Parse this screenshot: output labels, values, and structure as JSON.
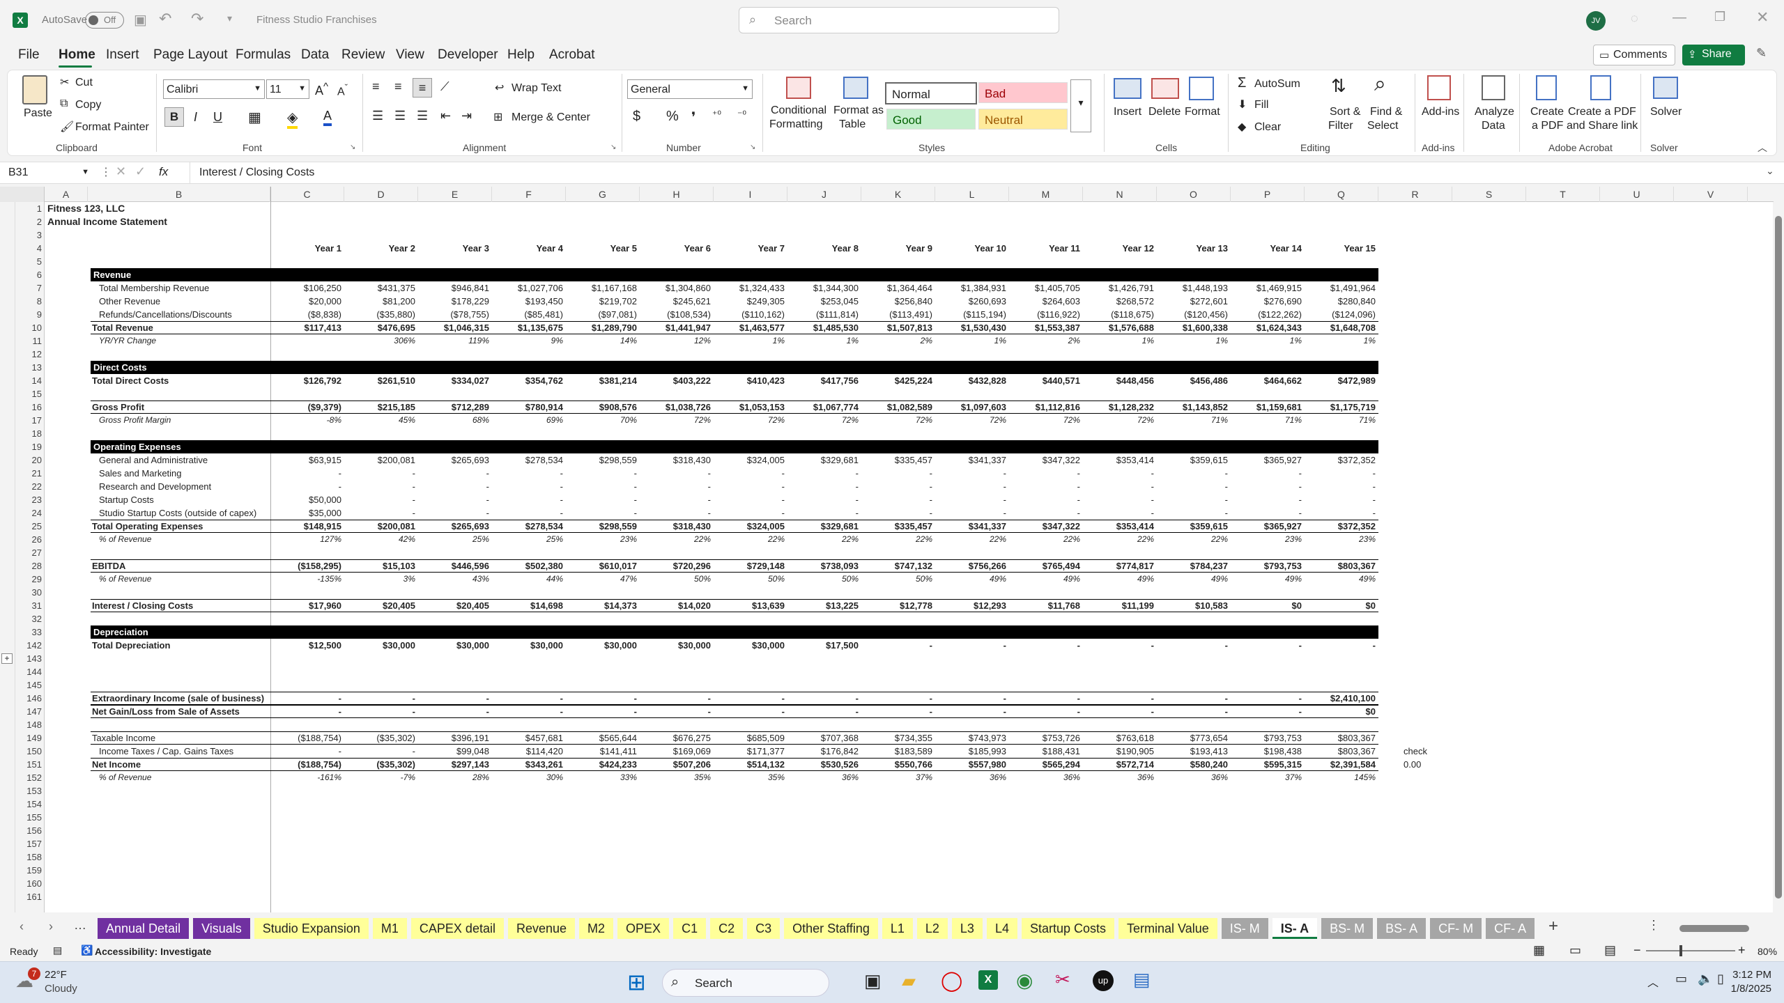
{
  "title": {
    "autosave": "AutoSave",
    "toggle": "Off",
    "filename": "Fitness Studio Franchises",
    "search": "Search",
    "avatar": "JV"
  },
  "menu": [
    "File",
    "Home",
    "Insert",
    "Page Layout",
    "Formulas",
    "Data",
    "Review",
    "View",
    "Developer",
    "Help",
    "Acrobat"
  ],
  "menu_right": {
    "comments": "Comments",
    "share": "Share"
  },
  "ribbon": {
    "paste": "Paste",
    "cut": "Cut",
    "copy": "Copy",
    "format_painter": "Format Painter",
    "clipboard": "Clipboard",
    "font_name": "Calibri",
    "font_size": "11",
    "font": "Font",
    "wrap_text": "Wrap Text",
    "merge_center": "Merge & Center",
    "alignment": "Alignment",
    "number_format": "General",
    "number": "Number",
    "cond_format": "Conditional",
    "cond_format2": "Formatting",
    "format_table": "Format as",
    "format_table2": "Table",
    "style_normal": "Normal",
    "style_bad": "Bad",
    "style_good": "Good",
    "style_neutral": "Neutral",
    "styles": "Styles",
    "insert": "Insert",
    "delete": "Delete",
    "format": "Format",
    "cells": "Cells",
    "autosum": "AutoSum",
    "fill": "Fill",
    "clear": "Clear",
    "sort": "Sort &",
    "sort2": "Filter",
    "find": "Find &",
    "find2": "Select",
    "editing": "Editing",
    "addins": "Add-ins",
    "addins_grp": "Add-ins",
    "analyze": "Analyze",
    "analyze2": "Data",
    "create_pdf": "Create",
    "create_pdf2": "a PDF",
    "create_share": "Create a PDF",
    "create_share2": "and Share link",
    "acrobat": "Adobe Acrobat",
    "solver": "Solver",
    "solver_grp": "Solver"
  },
  "formula_bar": {
    "cell_ref": "B31",
    "fx": "fx",
    "content": "Interest / Closing Costs"
  },
  "columns": [
    "A",
    "B",
    "C",
    "D",
    "E",
    "F",
    "G",
    "H",
    "I",
    "J",
    "K",
    "L",
    "M",
    "N",
    "O",
    "P",
    "Q",
    "R",
    "S",
    "T",
    "U",
    "V"
  ],
  "sheet": {
    "company": "Fitness 123, LLC",
    "statement": "Annual Income Statement",
    "years": [
      "Year 1",
      "Year 2",
      "Year 3",
      "Year 4",
      "Year 5",
      "Year 6",
      "Year 7",
      "Year 8",
      "Year 9",
      "Year 10",
      "Year 11",
      "Year 12",
      "Year 13",
      "Year 14",
      "Year 15"
    ],
    "rows": [
      {
        "n": "1"
      },
      {
        "n": "2"
      },
      {
        "n": "3"
      },
      {
        "n": "4",
        "years": true
      },
      {
        "n": "5"
      },
      {
        "n": "6",
        "band": "Revenue"
      },
      {
        "n": "7",
        "label": "Total Membership Revenue",
        "indent": true,
        "v": [
          "$106,250",
          "$431,375",
          "$946,841",
          "$1,027,706",
          "$1,167,168",
          "$1,304,860",
          "$1,324,433",
          "$1,344,300",
          "$1,364,464",
          "$1,384,931",
          "$1,405,705",
          "$1,426,791",
          "$1,448,193",
          "$1,469,915",
          "$1,491,964"
        ]
      },
      {
        "n": "8",
        "label": "Other Revenue",
        "indent": true,
        "v": [
          "$20,000",
          "$81,200",
          "$178,229",
          "$193,450",
          "$219,702",
          "$245,621",
          "$249,305",
          "$253,045",
          "$256,840",
          "$260,693",
          "$264,603",
          "$268,572",
          "$272,601",
          "$276,690",
          "$280,840"
        ]
      },
      {
        "n": "9",
        "label": "Refunds/Cancellations/Discounts",
        "indent": true,
        "v": [
          "($8,838)",
          "($35,880)",
          "($78,755)",
          "($85,481)",
          "($97,081)",
          "($108,534)",
          "($110,162)",
          "($111,814)",
          "($113,491)",
          "($115,194)",
          "($116,922)",
          "($118,675)",
          "($120,456)",
          "($122,262)",
          "($124,096)"
        ]
      },
      {
        "n": "10",
        "label": "Total Revenue",
        "bold": true,
        "top": true,
        "v": [
          "$117,413",
          "$476,695",
          "$1,046,315",
          "$1,135,675",
          "$1,289,790",
          "$1,441,947",
          "$1,463,577",
          "$1,485,530",
          "$1,507,813",
          "$1,530,430",
          "$1,553,387",
          "$1,576,688",
          "$1,600,338",
          "$1,624,343",
          "$1,648,708"
        ]
      },
      {
        "n": "11",
        "label": "YR/YR Change",
        "ital": true,
        "v": [
          "",
          "306%",
          "119%",
          "9%",
          "14%",
          "12%",
          "1%",
          "1%",
          "2%",
          "1%",
          "2%",
          "1%",
          "1%",
          "1%",
          "1%"
        ]
      },
      {
        "n": "12"
      },
      {
        "n": "13",
        "band": "Direct Costs"
      },
      {
        "n": "14",
        "label": "Total Direct Costs",
        "bold": true,
        "v": [
          "$126,792",
          "$261,510",
          "$334,027",
          "$354,762",
          "$381,214",
          "$403,222",
          "$410,423",
          "$417,756",
          "$425,224",
          "$432,828",
          "$440,571",
          "$448,456",
          "$456,486",
          "$464,662",
          "$472,989"
        ]
      },
      {
        "n": "15"
      },
      {
        "n": "16",
        "label": "Gross Profit",
        "bold": true,
        "top": true,
        "v": [
          "($9,379)",
          "$215,185",
          "$712,289",
          "$780,914",
          "$908,576",
          "$1,038,726",
          "$1,053,153",
          "$1,067,774",
          "$1,082,589",
          "$1,097,603",
          "$1,112,816",
          "$1,128,232",
          "$1,143,852",
          "$1,159,681",
          "$1,175,719"
        ]
      },
      {
        "n": "17",
        "label": "Gross Profit Margin",
        "ital": true,
        "v": [
          "-8%",
          "45%",
          "68%",
          "69%",
          "70%",
          "72%",
          "72%",
          "72%",
          "72%",
          "72%",
          "72%",
          "72%",
          "71%",
          "71%",
          "71%"
        ]
      },
      {
        "n": "18"
      },
      {
        "n": "19",
        "band": "Operating Expenses"
      },
      {
        "n": "20",
        "label": "General and Administrative",
        "indent": true,
        "v": [
          "$63,915",
          "$200,081",
          "$265,693",
          "$278,534",
          "$298,559",
          "$318,430",
          "$324,005",
          "$329,681",
          "$335,457",
          "$341,337",
          "$347,322",
          "$353,414",
          "$359,615",
          "$365,927",
          "$372,352"
        ]
      },
      {
        "n": "21",
        "label": "Sales and Marketing",
        "indent": true,
        "v": [
          "-",
          "-",
          "-",
          "-",
          "-",
          "-",
          "-",
          "-",
          "-",
          "-",
          "-",
          "-",
          "-",
          "-",
          "-"
        ]
      },
      {
        "n": "22",
        "label": "Research and Development",
        "indent": true,
        "v": [
          "-",
          "-",
          "-",
          "-",
          "-",
          "-",
          "-",
          "-",
          "-",
          "-",
          "-",
          "-",
          "-",
          "-",
          "-"
        ]
      },
      {
        "n": "23",
        "label": "Startup Costs",
        "indent": true,
        "v": [
          "$50,000",
          "-",
          "-",
          "-",
          "-",
          "-",
          "-",
          "-",
          "-",
          "-",
          "-",
          "-",
          "-",
          "-",
          "-"
        ]
      },
      {
        "n": "24",
        "label": "Studio Startup Costs (outside of capex)",
        "indent": true,
        "v": [
          "$35,000",
          "-",
          "-",
          "-",
          "-",
          "-",
          "-",
          "-",
          "-",
          "-",
          "-",
          "-",
          "-",
          "-",
          "-"
        ]
      },
      {
        "n": "25",
        "label": "Total Operating Expenses",
        "bold": true,
        "top": true,
        "v": [
          "$148,915",
          "$200,081",
          "$265,693",
          "$278,534",
          "$298,559",
          "$318,430",
          "$324,005",
          "$329,681",
          "$335,457",
          "$341,337",
          "$347,322",
          "$353,414",
          "$359,615",
          "$365,927",
          "$372,352"
        ]
      },
      {
        "n": "26",
        "label": "% of Revenue",
        "ital": true,
        "v": [
          "127%",
          "42%",
          "25%",
          "25%",
          "23%",
          "22%",
          "22%",
          "22%",
          "22%",
          "22%",
          "22%",
          "22%",
          "22%",
          "23%",
          "23%"
        ]
      },
      {
        "n": "27"
      },
      {
        "n": "28",
        "label": "EBITDA",
        "bold": true,
        "top": true,
        "v": [
          "($158,295)",
          "$15,103",
          "$446,596",
          "$502,380",
          "$610,017",
          "$720,296",
          "$729,148",
          "$738,093",
          "$747,132",
          "$756,266",
          "$765,494",
          "$774,817",
          "$784,237",
          "$793,753",
          "$803,367"
        ]
      },
      {
        "n": "29",
        "label": "% of Revenue",
        "ital": true,
        "v": [
          "-135%",
          "3%",
          "43%",
          "44%",
          "47%",
          "50%",
          "50%",
          "50%",
          "50%",
          "49%",
          "49%",
          "49%",
          "49%",
          "49%",
          "49%"
        ]
      },
      {
        "n": "30"
      },
      {
        "n": "31",
        "label": "Interest / Closing Costs",
        "bold": true,
        "top": true,
        "v": [
          "$17,960",
          "$20,405",
          "$20,405",
          "$14,698",
          "$14,373",
          "$14,020",
          "$13,639",
          "$13,225",
          "$12,778",
          "$12,293",
          "$11,768",
          "$11,199",
          "$10,583",
          "$0",
          "$0"
        ]
      },
      {
        "n": "32"
      },
      {
        "n": "33",
        "band": "Depreciation"
      },
      {
        "n": "142",
        "label": "Total Depreciation",
        "bold": true,
        "v": [
          "$12,500",
          "$30,000",
          "$30,000",
          "$30,000",
          "$30,000",
          "$30,000",
          "$30,000",
          "$17,500",
          "-",
          "-",
          "-",
          "-",
          "-",
          "-",
          "-"
        ]
      },
      {
        "n": "143"
      },
      {
        "n": "144"
      },
      {
        "n": "145"
      },
      {
        "n": "146",
        "label": "Extraordinary Income (sale of business)",
        "bold": true,
        "top": true,
        "v": [
          "-",
          "-",
          "-",
          "-",
          "-",
          "-",
          "-",
          "-",
          "-",
          "-",
          "-",
          "-",
          "-",
          "-",
          "$2,410,100"
        ]
      },
      {
        "n": "147",
        "label": "Net Gain/Loss from Sale of Assets",
        "bold": true,
        "top": true,
        "v": [
          "-",
          "-",
          "-",
          "-",
          "-",
          "-",
          "-",
          "-",
          "-",
          "-",
          "-",
          "-",
          "-",
          "-",
          "$0"
        ]
      },
      {
        "n": "148"
      },
      {
        "n": "149",
        "label": "Taxable Income",
        "top": true,
        "v": [
          "($188,754)",
          "($35,302)",
          "$396,191",
          "$457,681",
          "$565,644",
          "$676,275",
          "$685,509",
          "$707,368",
          "$734,355",
          "$743,973",
          "$753,726",
          "$763,618",
          "$773,654",
          "$793,753",
          "$803,367"
        ]
      },
      {
        "n": "150",
        "label": "Income Taxes / Cap. Gains Taxes",
        "indent": true,
        "v": [
          "-",
          "-",
          "$99,048",
          "$114,420",
          "$141,411",
          "$169,069",
          "$171,377",
          "$176,842",
          "$183,589",
          "$185,993",
          "$188,431",
          "$190,905",
          "$193,413",
          "$198,438",
          "$803,367"
        ],
        "extra": "check"
      },
      {
        "n": "151",
        "label": "Net Income",
        "bold": true,
        "top": true,
        "v": [
          "($188,754)",
          "($35,302)",
          "$297,143",
          "$343,261",
          "$424,233",
          "$507,206",
          "$514,132",
          "$530,526",
          "$550,766",
          "$557,980",
          "$565,294",
          "$572,714",
          "$580,240",
          "$595,315",
          "$2,391,584"
        ],
        "extra": "0.00"
      },
      {
        "n": "152",
        "label": "% of Revenue",
        "ital": true,
        "v": [
          "-161%",
          "-7%",
          "28%",
          "30%",
          "33%",
          "35%",
          "35%",
          "36%",
          "37%",
          "36%",
          "36%",
          "36%",
          "36%",
          "37%",
          "145%"
        ]
      },
      {
        "n": "153"
      },
      {
        "n": "154"
      },
      {
        "n": "155"
      },
      {
        "n": "156"
      },
      {
        "n": "157"
      },
      {
        "n": "158"
      },
      {
        "n": "159"
      },
      {
        "n": "160"
      },
      {
        "n": "161"
      }
    ]
  },
  "tabs": [
    {
      "name": "Annual Detail",
      "bg": "#7030a0",
      "fg": "#ffffff"
    },
    {
      "name": "Visuals",
      "bg": "#7030a0",
      "fg": "#ffffff"
    },
    {
      "name": "Studio Expansion",
      "bg": "#ffff99",
      "fg": "#242424"
    },
    {
      "name": "M1",
      "bg": "#ffff99",
      "fg": "#242424"
    },
    {
      "name": "CAPEX detail",
      "bg": "#ffff99",
      "fg": "#242424"
    },
    {
      "name": "Revenue",
      "bg": "#ffff99",
      "fg": "#242424"
    },
    {
      "name": "M2",
      "bg": "#ffff99",
      "fg": "#242424"
    },
    {
      "name": "OPEX",
      "bg": "#ffff99",
      "fg": "#242424"
    },
    {
      "name": "C1",
      "bg": "#ffff99",
      "fg": "#242424"
    },
    {
      "name": "C2",
      "bg": "#ffff99",
      "fg": "#242424"
    },
    {
      "name": "C3",
      "bg": "#ffff99",
      "fg": "#242424"
    },
    {
      "name": "Other Staffing",
      "bg": "#ffff99",
      "fg": "#242424"
    },
    {
      "name": "L1",
      "bg": "#ffff99",
      "fg": "#242424"
    },
    {
      "name": "L2",
      "bg": "#ffff99",
      "fg": "#242424"
    },
    {
      "name": "L3",
      "bg": "#ffff99",
      "fg": "#242424"
    },
    {
      "name": "L4",
      "bg": "#ffff99",
      "fg": "#242424"
    },
    {
      "name": "Startup Costs",
      "bg": "#ffff99",
      "fg": "#242424"
    },
    {
      "name": "Terminal Value",
      "bg": "#ffff99",
      "fg": "#242424"
    },
    {
      "name": "IS- M",
      "bg": "#a6a6a6",
      "fg": "#ffffff"
    },
    {
      "name": "IS- A",
      "bg": "#ffffff",
      "fg": "#242424",
      "active": true
    },
    {
      "name": "BS- M",
      "bg": "#a6a6a6",
      "fg": "#ffffff"
    },
    {
      "name": "BS- A",
      "bg": "#a6a6a6",
      "fg": "#ffffff"
    },
    {
      "name": "CF- M",
      "bg": "#a6a6a6",
      "fg": "#ffffff"
    },
    {
      "name": "CF- A",
      "bg": "#a6a6a6",
      "fg": "#ffffff"
    }
  ],
  "status": {
    "ready": "Ready",
    "accessibility": "Accessibility: Investigate",
    "zoom": "80%"
  },
  "taskbar": {
    "temp": "22°F",
    "weather": "Cloudy",
    "badge": "7",
    "search": "Search",
    "time": "3:12 PM",
    "date": "1/8/2025"
  }
}
